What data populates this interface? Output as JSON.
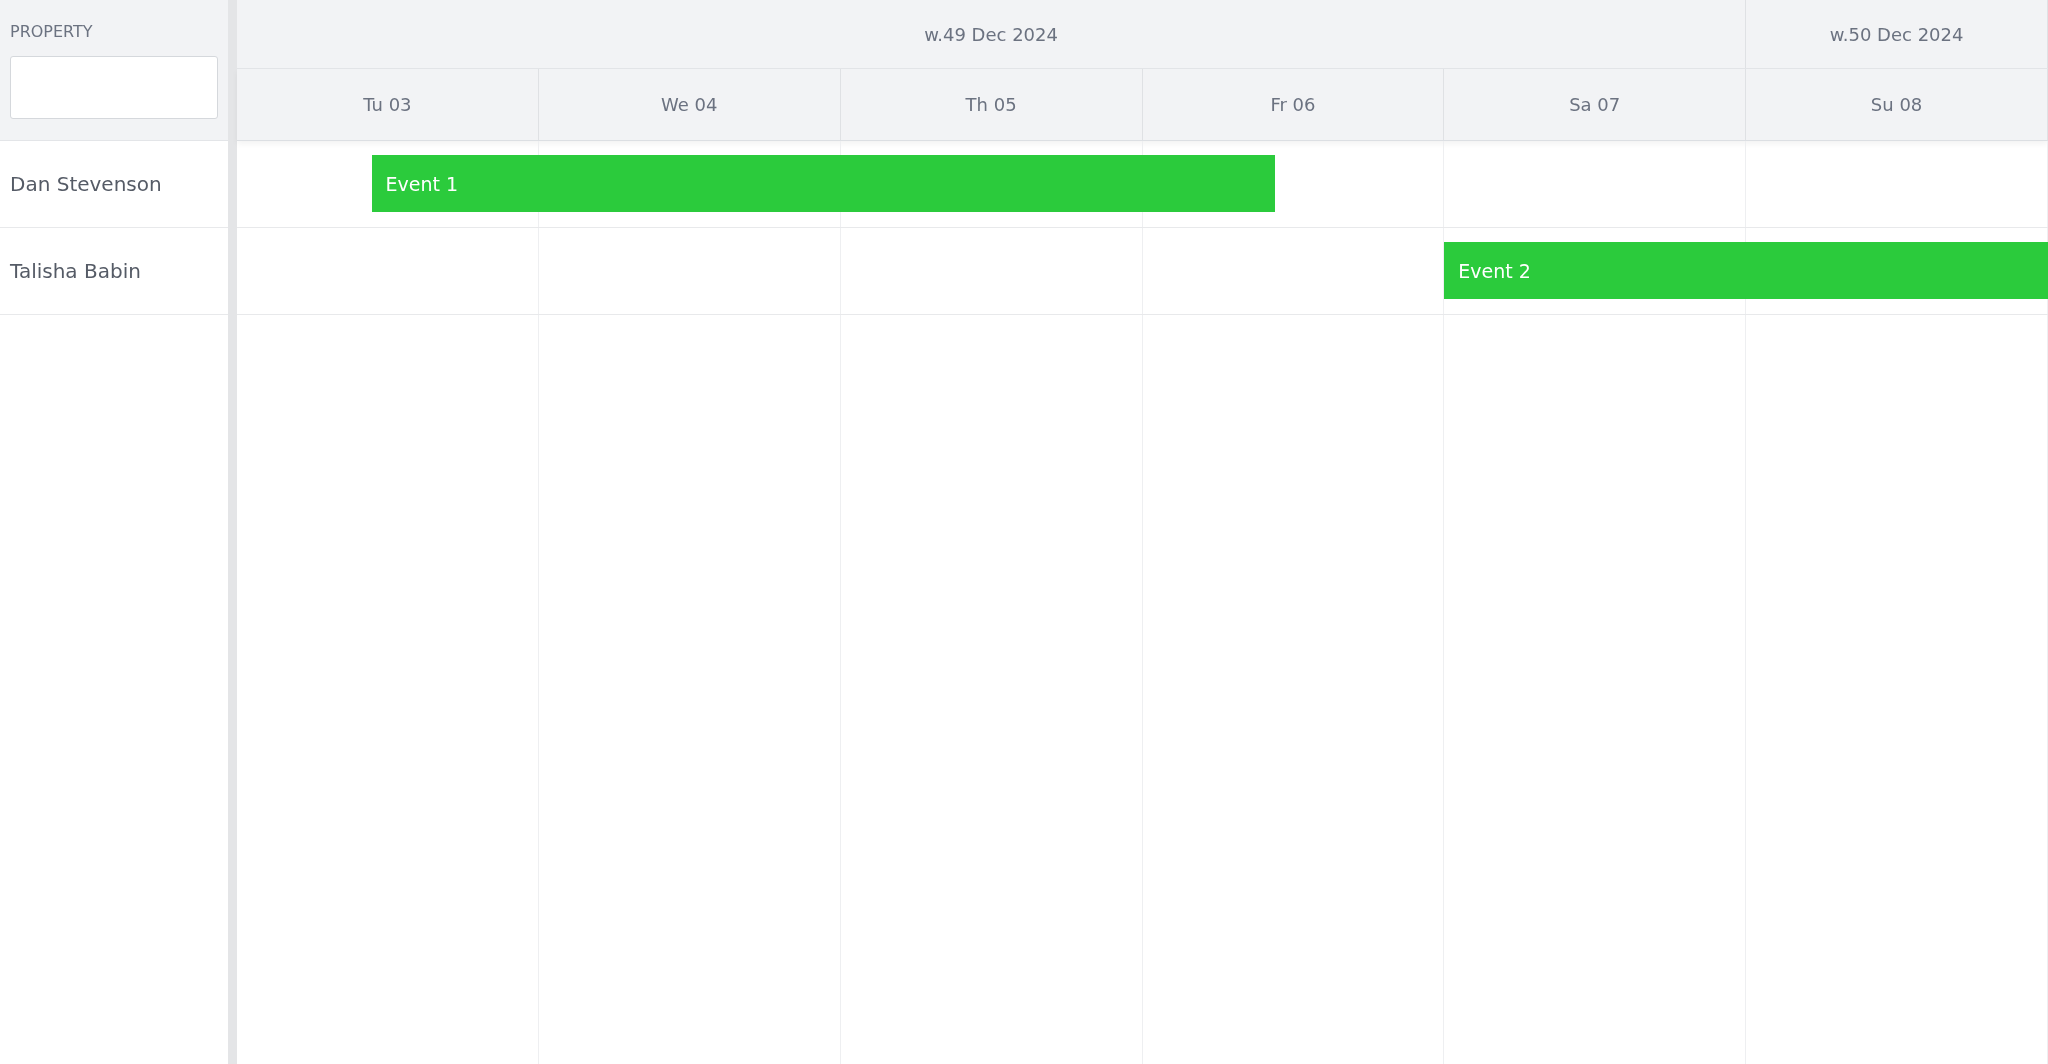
{
  "sidebar": {
    "header": "PROPERTY"
  },
  "weeks": [
    "w.49 Dec 2024",
    "w.50 Dec 2024"
  ],
  "days": [
    "Tu 03",
    "We 04",
    "Th 05",
    "Fr 06",
    "Sa 07",
    "Su 08"
  ],
  "resources": [
    {
      "name": "Dan Stevenson",
      "events": [
        {
          "label": "Event 1",
          "color": "#2bcb3c"
        }
      ]
    },
    {
      "name": "Talisha Babin",
      "events": [
        {
          "label": "Event 2",
          "color": "#2bcb3c"
        }
      ]
    }
  ]
}
